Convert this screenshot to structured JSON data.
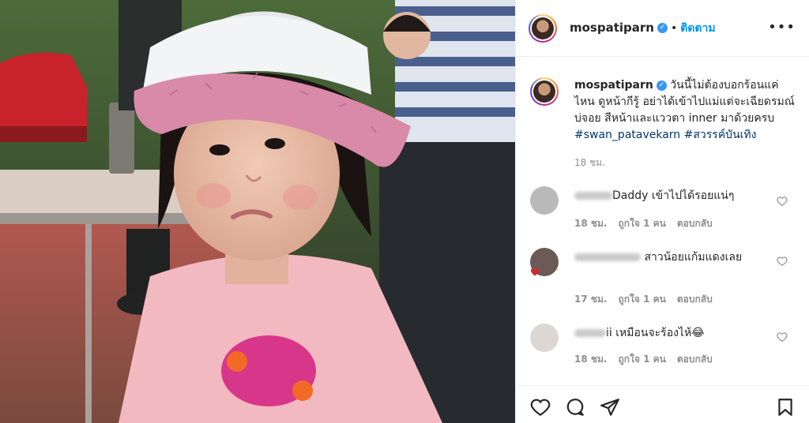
{
  "post": {
    "username": "mospatiparn",
    "follow_label": "ติดตาม",
    "separator": "•",
    "more_label": "•••",
    "caption": {
      "username": "mospatiparn",
      "text": "วันนี้ไม่ต้องบอกร้อนแค่ไหน ดูหน้ากีรู้ อย่าได้เข้าไปแม่แต่จะเฉียดรมณ์บ่จอย สีหน้าและแววตา inner มาด้วยครบ",
      "tags": [
        "#swan_patavekarn",
        "#สวรรค์บันเทิง"
      ],
      "time": "18 ชม."
    },
    "comments": [
      {
        "username": "aun_sr",
        "text": "Daddy เข้าไปได้รอยแน่ๆ",
        "time": "18 ชม.",
        "likes": "ถูกใจ 1 คน",
        "reply": "ตอบกลับ",
        "avatar_color": "#b9b9b9"
      },
      {
        "username": "marnwsdoory",
        "text": "สาวน้อยแก้มแดงเลย",
        "time": "17 ชม.",
        "likes": "ถูกใจ 1 คน",
        "reply": "ตอบกลับ",
        "avatar_color": "#6b5a55"
      },
      {
        "username": "natvaii",
        "text": "ii เหมือนจะร้องไห้😂",
        "time": "18 ชม.",
        "likes": "ถูกใจ 1 คน",
        "reply": "ตอบกลับ",
        "avatar_color": "#ddd7d4"
      }
    ]
  },
  "icons": {
    "like": "heart-icon",
    "comment": "comment-icon",
    "share": "paper-plane-icon",
    "save": "bookmark-icon",
    "verified": "verified-badge-icon",
    "more": "more-options-icon"
  },
  "colors": {
    "link": "#0095f6",
    "hashtag": "#00376b",
    "muted": "#8e8e8e",
    "verified": "#3897f0"
  }
}
